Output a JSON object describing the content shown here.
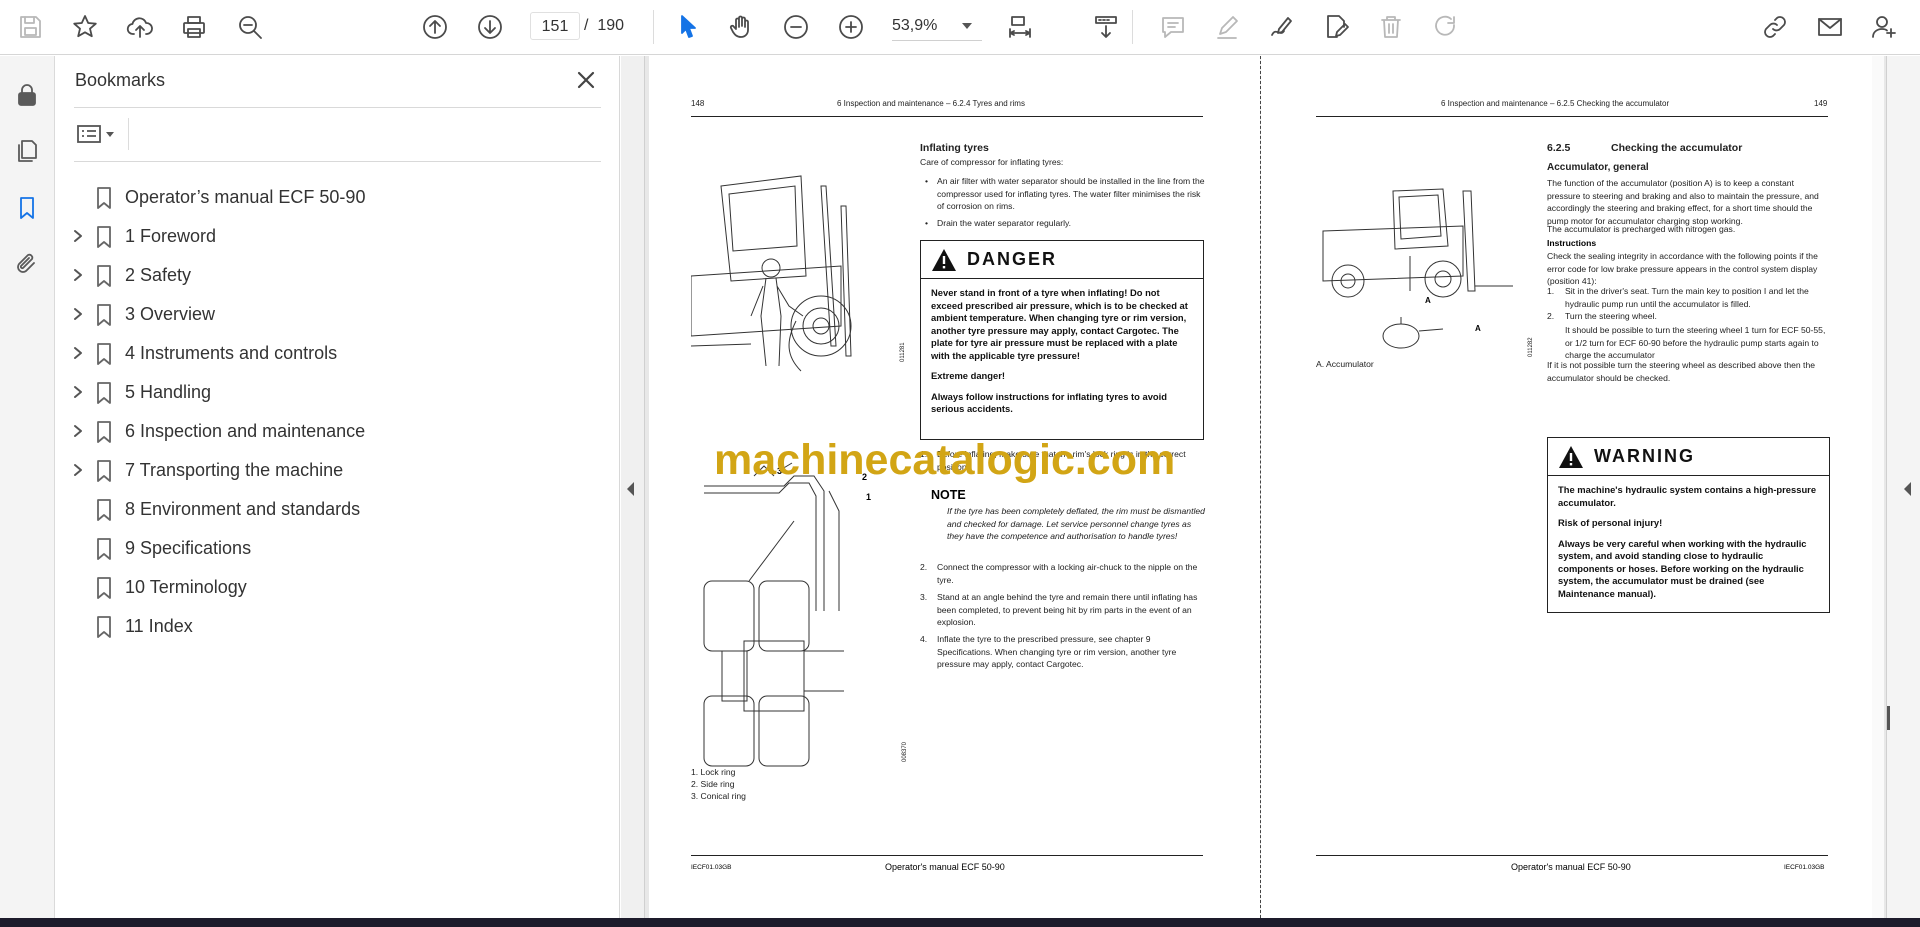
{
  "toolbar": {
    "current_page": "151",
    "page_separator": "/",
    "total_pages": "190",
    "zoom": "53,9%"
  },
  "sidebar": {
    "title": "Bookmarks",
    "items": [
      {
        "label": "Operator’s manual ECF 50-90",
        "expandable": false
      },
      {
        "label": "1 Foreword",
        "expandable": true
      },
      {
        "label": "2 Safety",
        "expandable": true
      },
      {
        "label": "3 Overview",
        "expandable": true
      },
      {
        "label": "4 Instruments and controls",
        "expandable": true
      },
      {
        "label": "5 Handling",
        "expandable": true
      },
      {
        "label": "6 Inspection and maintenance",
        "expandable": true
      },
      {
        "label": "7 Transporting the machine",
        "expandable": true
      },
      {
        "label": "8 Environment and standards",
        "expandable": false
      },
      {
        "label": "9 Specifications",
        "expandable": false
      },
      {
        "label": "10 Terminology",
        "expandable": false
      },
      {
        "label": "11 Index",
        "expandable": false
      }
    ]
  },
  "watermark": "machinecatalogic.com",
  "left_page": {
    "page_number": "148",
    "header": "6 Inspection and maintenance – 6.2.4 Tyres and rims",
    "heading": "Inflating tyres",
    "intro": "Care of compressor for inflating tyres:",
    "bullets": [
      "An air filter with water separator should be installed in the line from the compressor used for inflating tyres. The water filter minimises the risk of corrosion on rims.",
      "Drain the water separator regularly."
    ],
    "danger": {
      "title": "DANGER",
      "p1": "Never stand in front of a tyre when inflating! Do not exceed prescribed air pressure, which is to be checked at ambient temperature. When changing tyre or rim version, another tyre pressure may apply, contact Cargotec. The plate for tyre air pressure must be replaced with a plate with the applicable tyre pressure!",
      "p2": "Extreme danger!",
      "p3": "Always follow instructions for inflating tyres to avoid serious accidents."
    },
    "step1_num": "1.",
    "step1": "Before inflating, make sure that the rim's lock ring is in the correct position.",
    "note_title": "NOTE",
    "note_text": "If the tyre has been completely deflated, the rim must be dismantled and checked for damage. Let service personnel change tyres as they have the competence and authorisation to handle tyres!",
    "step2_num": "2.",
    "step2": "Connect the compressor with a locking air-chuck to the nipple on the tyre.",
    "step3_num": "3.",
    "step3": "Stand at an angle behind the tyre and remain there until inflating has been completed, to prevent being hit by rim parts in the event of an explosion.",
    "step4_num": "4.",
    "step4": "Inflate the tyre to the prescribed pressure, see chapter 9 Specifications. When changing tyre or rim version, another tyre pressure may apply, contact Cargotec.",
    "fig1_code": "011281",
    "fig2_code": "008370",
    "fig2_callouts": [
      "1",
      "2",
      "3"
    ],
    "captions": [
      "1. Lock ring",
      "2. Side ring",
      "3. Conical ring"
    ],
    "footer_code": "IECF01.03GB",
    "footer_title": "Operator's manual ECF 50-90"
  },
  "right_page": {
    "page_number": "149",
    "header": "6 Inspection and maintenance – 6.2.5 Checking the accumulator",
    "section_number": "6.2.5",
    "section_title": "Checking the accumulator",
    "subheading": "Accumulator, general",
    "p1": "The function of the accumulator (position A) is to keep a constant pressure to steering and braking and also to maintain the pressure, and accordingly the steering and braking effect, for a short time should the pump motor for accumulator charging stop working.",
    "p2": "The accumulator is precharged with nitrogen gas.",
    "instructions_heading": "Instructions",
    "p3": "Check the sealing integrity in accordance with the following points if the error code for low brake pressure appears in the control system display (position 41):",
    "step1_num": "1.",
    "step1": "Sit in the driver's seat. Turn the main key to position I and let the hydraulic pump run until the accumulator is filled.",
    "step2_num": "2.",
    "step2": "Turn the steering wheel.",
    "step2b": "It should be possible to turn the steering wheel 1 turn for ECF 50-55, or 1/2 turn for ECF 60-90 before the hydraulic pump starts again to charge the accumulator",
    "p4": "If it is not possible turn the steering wheel as described above then the accumulator should be checked.",
    "warning": {
      "title": "WARNING",
      "p1": "The machine's hydraulic system contains a high-pressure accumulator.",
      "p2": "Risk of personal injury!",
      "p3": "Always be very careful when working with the hydraulic system, and avoid standing close to hydraulic components or hoses. Before working on the hydraulic system, the accumulator must be drained (see Maintenance manual)."
    },
    "fig_label_a1": "A",
    "fig_label_a2": "A",
    "fig_code": "011282",
    "caption": "A. Accumulator",
    "footer_title": "Operator's manual ECF 50-90",
    "footer_code": "IECF01.03GB"
  }
}
